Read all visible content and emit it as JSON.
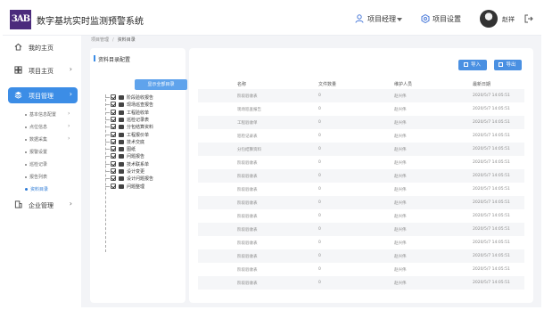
{
  "header": {
    "logo_text": "3AB",
    "app_title": "数字基坑实时监测预警系统",
    "role_label": "项目经理",
    "settings_label": "项目设置",
    "user_name": "赵祥"
  },
  "sidebar": {
    "items": [
      {
        "label": "我的主页",
        "icon": "home-icon"
      },
      {
        "label": "项目主页",
        "icon": "dashboard-icon",
        "chevron": "›"
      },
      {
        "label": "项目管理",
        "icon": "layers-icon",
        "chevron": "›",
        "active": true
      },
      {
        "label": "企业管理",
        "icon": "building-icon",
        "chevron": "›"
      }
    ],
    "sub_items": [
      {
        "label": "基本信息配置",
        "chevron": "›"
      },
      {
        "label": "点位信息",
        "chevron": "›"
      },
      {
        "label": "数据采集",
        "chevron": "›"
      },
      {
        "label": "报警设置"
      },
      {
        "label": "巡检记录"
      },
      {
        "label": "报告列表"
      },
      {
        "label": "资料目录",
        "active": true
      }
    ]
  },
  "breadcrumb": {
    "parent": "项目管理",
    "separator": "/",
    "current": "资料目录"
  },
  "tree_panel": {
    "title": "资料目录配置",
    "show_all_button": "显示全部目录",
    "nodes": [
      "阶段验收报告",
      "现场巡查报告",
      "工程验收单",
      "巡检记录表",
      "分包结算资料",
      "工程报价单",
      "技术交底",
      "图纸",
      "问题报告",
      "技术联系单",
      "设计变更",
      "设计问题报告",
      "问题整理"
    ]
  },
  "table_panel": {
    "import_label": "导入",
    "export_label": "导出",
    "columns": [
      "名称",
      "文件数量",
      "维护人员",
      "最新日期"
    ],
    "rows": [
      [
        "阶段验收表",
        "0",
        "赵兴伟",
        "2020/5/7 14:05:51"
      ],
      [
        "现场巡查报告",
        "0",
        "赵兴伟",
        "2020/5/7 14:05:51"
      ],
      [
        "工程验收单",
        "0",
        "赵兴伟",
        "2020/5/7 14:05:51"
      ],
      [
        "巡检记录表",
        "0",
        "赵兴伟",
        "2020/5/7 14:05:51"
      ],
      [
        "分包结算资料",
        "0",
        "赵兴伟",
        "2020/5/7 14:05:51"
      ],
      [
        "阶段验收表",
        "0",
        "赵兴伟",
        "2020/5/7 14:05:51"
      ],
      [
        "阶段验收表",
        "0",
        "赵兴伟",
        "2020/5/7 14:05:51"
      ],
      [
        "阶段验收表",
        "0",
        "赵兴伟",
        "2020/5/7 14:05:51"
      ],
      [
        "阶段验收表",
        "0",
        "赵兴伟",
        "2020/5/7 14:05:51"
      ],
      [
        "阶段验收表",
        "0",
        "赵兴伟",
        "2020/5/7 14:05:51"
      ],
      [
        "阶段验收表",
        "0",
        "赵兴伟",
        "2020/5/7 14:05:51"
      ],
      [
        "阶段验收表",
        "0",
        "赵兴伟",
        "2020/5/7 14:05:51"
      ],
      [
        "阶段验收表",
        "0",
        "赵兴伟",
        "2020/5/7 14:05:51"
      ],
      [
        "阶段验收表",
        "0",
        "赵兴伟",
        "2020/5/7 14:05:51"
      ],
      [
        "阶段验收表",
        "0",
        "赵兴伟",
        "2020/5/7 14:05:51"
      ]
    ]
  },
  "colors": {
    "accent": "#3c8de6",
    "logo_bg": "#4b2b7c",
    "content_bg": "#f3f4f7"
  }
}
